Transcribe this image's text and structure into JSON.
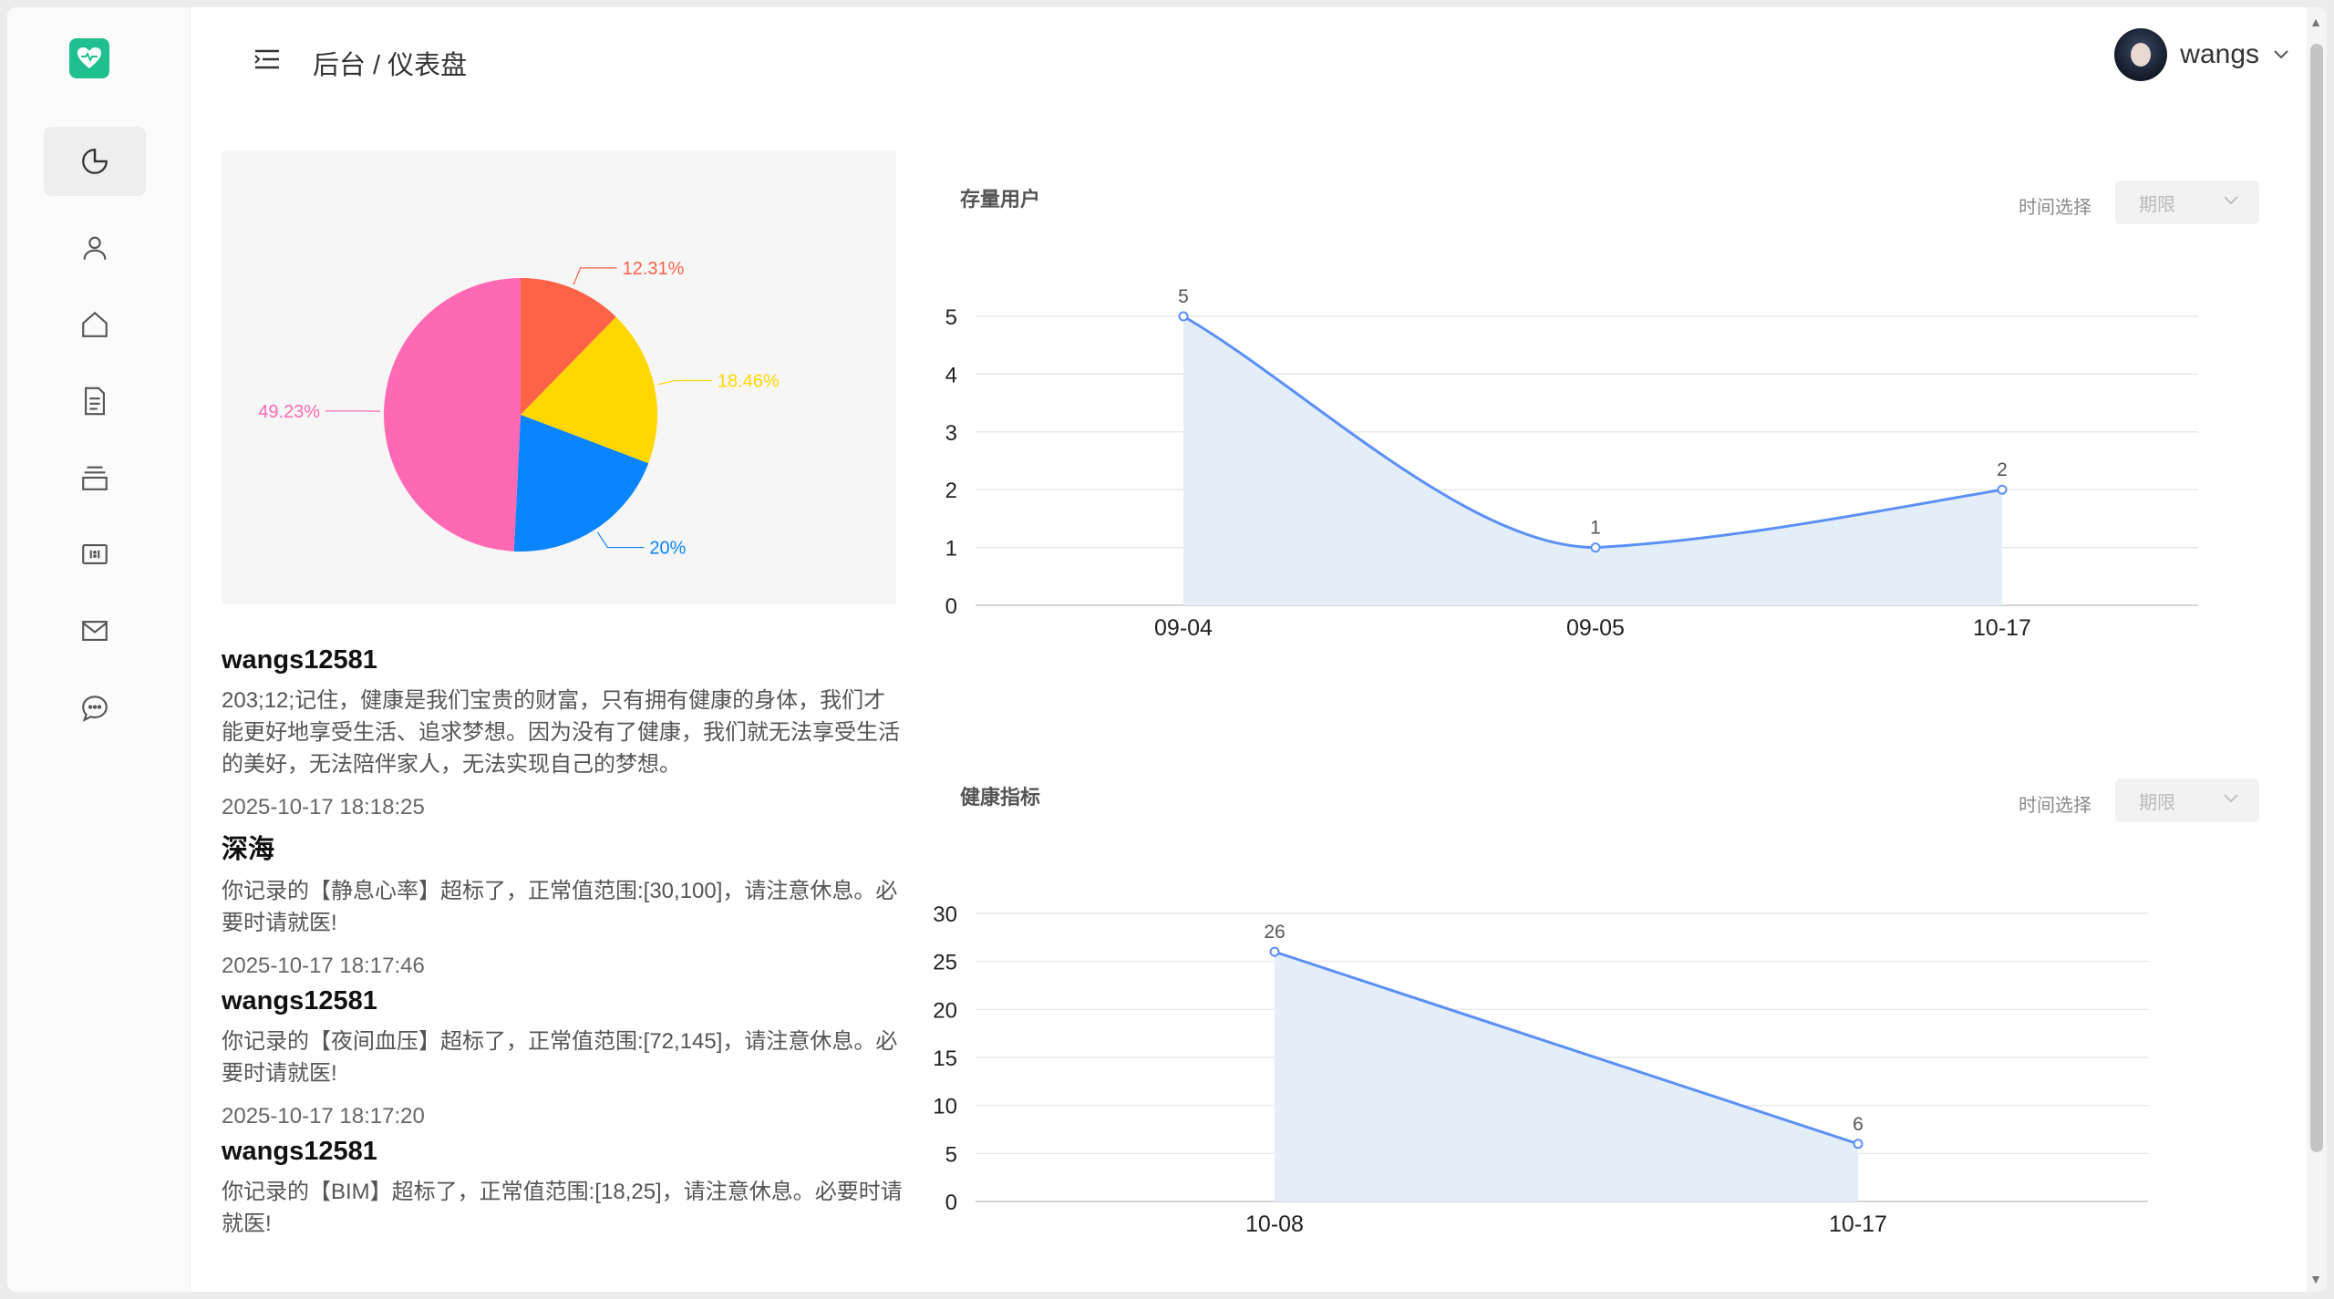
{
  "header": {
    "breadcrumb": "后台 / 仪表盘",
    "username": "wangs"
  },
  "sidebar": {
    "icons": [
      "pie-chart-icon",
      "user-icon",
      "home-icon",
      "document-icon",
      "layers-icon",
      "ratio-icon",
      "mail-icon",
      "chat-icon"
    ]
  },
  "pie": {
    "labels": [
      "12.31%",
      "18.46%",
      "20%",
      "49.23%"
    ]
  },
  "feed": [
    {
      "user": "wangs12581",
      "text": "203;12;记住，健康是我们宝贵的财富，只有拥有健康的身体，我们才能更好地享受生活、追求梦想。因为没有了健康，我们就无法享受生活的美好，无法陪伴家人，无法实现自己的梦想。",
      "time": "2025-10-17 18:18:25"
    },
    {
      "user": "深海",
      "text": "你记录的【静息心率】超标了，正常值范围:[30,100]，请注意休息。必要时请就医!",
      "time": "2025-10-17 18:17:46"
    },
    {
      "user": "wangs12581",
      "text": "你记录的【夜间血压】超标了，正常值范围:[72,145]，请注意休息。必要时请就医!",
      "time": "2025-10-17 18:17:20"
    },
    {
      "user": "wangs12581",
      "text": "你记录的【BIM】超标了，正常值范围:[18,25]，请注意休息。必要时请就医!",
      "time": ""
    }
  ],
  "chart1": {
    "title": "存量用户",
    "time_label": "时间选择",
    "select_placeholder": "期限"
  },
  "chart2": {
    "title": "健康指标",
    "time_label": "时间选择",
    "select_placeholder": "期限"
  },
  "colors": {
    "accent": "#5b8ff9",
    "area": "#e3eef9",
    "logo": "#1fbf8f",
    "pie": [
      "#ff6347",
      "#ffd700",
      "#0a84ff",
      "#ff69b4"
    ]
  },
  "chart_data": [
    {
      "type": "pie",
      "values": [
        12.31,
        18.46,
        20,
        49.23
      ],
      "labels": [
        "12.31%",
        "18.46%",
        "20%",
        "49.23%"
      ],
      "colors": [
        "#ff6347",
        "#ffd700",
        "#0a84ff",
        "#ff69b4"
      ]
    },
    {
      "type": "area",
      "title": "存量用户",
      "categories": [
        "09-04",
        "09-05",
        "10-17"
      ],
      "values": [
        5,
        1,
        2
      ],
      "yticks": [
        "0",
        "1",
        "2",
        "3",
        "4",
        "5"
      ],
      "ylim": [
        0,
        5
      ],
      "grid": true
    },
    {
      "type": "area",
      "title": "健康指标",
      "categories": [
        "10-08",
        "10-17"
      ],
      "values": [
        26,
        6
      ],
      "yticks": [
        "0",
        "5",
        "10",
        "15",
        "20",
        "25",
        "30"
      ],
      "ylim": [
        0,
        30
      ],
      "grid": true
    }
  ]
}
